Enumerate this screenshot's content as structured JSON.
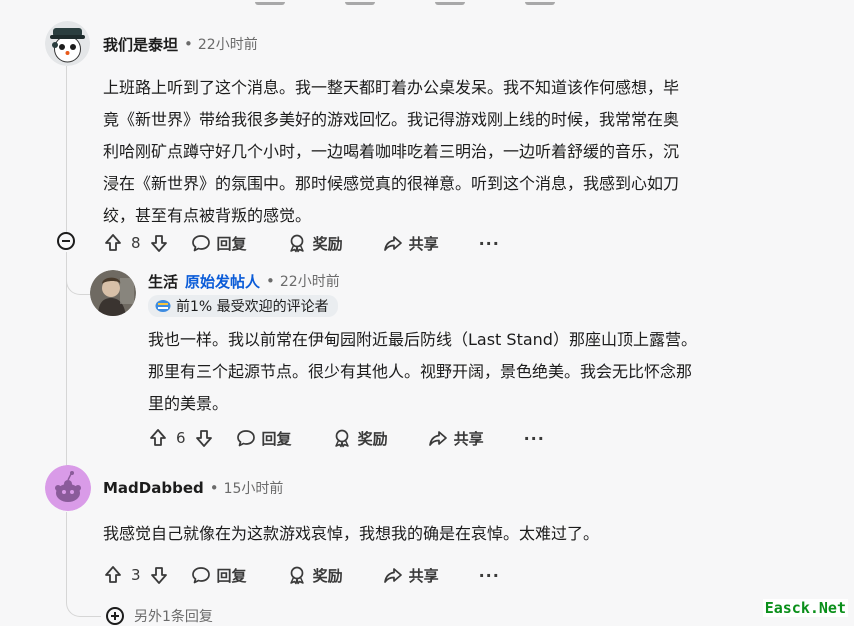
{
  "comments": [
    {
      "author": "我们是泰坦",
      "time": "22小时前",
      "body": [
        "上班路上听到了这个消息。我一整天都盯着办公桌发呆。我不知道该作何感想，毕",
        "竟《新世界》带给我很多美好的游戏回忆。我记得游戏刚上线的时候，我常常在奥",
        "利哈刚矿点蹲守好几个小时，一边喝着咖啡吃着三明治，一边听着舒缓的音乐，沉",
        "浸在《新世界》的氛围中。那时候感觉真的很禅意。听到这个消息，我感到心如刀",
        "绞，甚至有点被背叛的感觉。"
      ],
      "votes": "8"
    },
    {
      "author": "生活",
      "op_badge": "原始发帖人",
      "time": "22小时前",
      "flair": "前1% 最受欢迎的评论者",
      "body": [
        "我也一样。我以前常在伊甸园附近最后防线（Last Stand）那座山顶上露营。",
        "那里有三个起源节点。很少有其他人。视野开阔，景色绝美。我会无比怀念那",
        "里的美景。"
      ],
      "votes": "6"
    },
    {
      "author": "MadDabbed",
      "time": "15小时前",
      "body": [
        "我感觉自己就像在为这款游戏哀悼，我想我的确是在哀悼。太难过了。"
      ],
      "votes": "3"
    }
  ],
  "actions": {
    "reply": "回复",
    "award": "奖励",
    "share": "共享",
    "more": "···"
  },
  "more_replies": "另外1条回复",
  "watermark": "Easck.Net",
  "colors": {
    "op_blue": "#0b5cd8",
    "meta_gray": "#6b6b6b",
    "watermark_green": "#0a8f1a"
  }
}
